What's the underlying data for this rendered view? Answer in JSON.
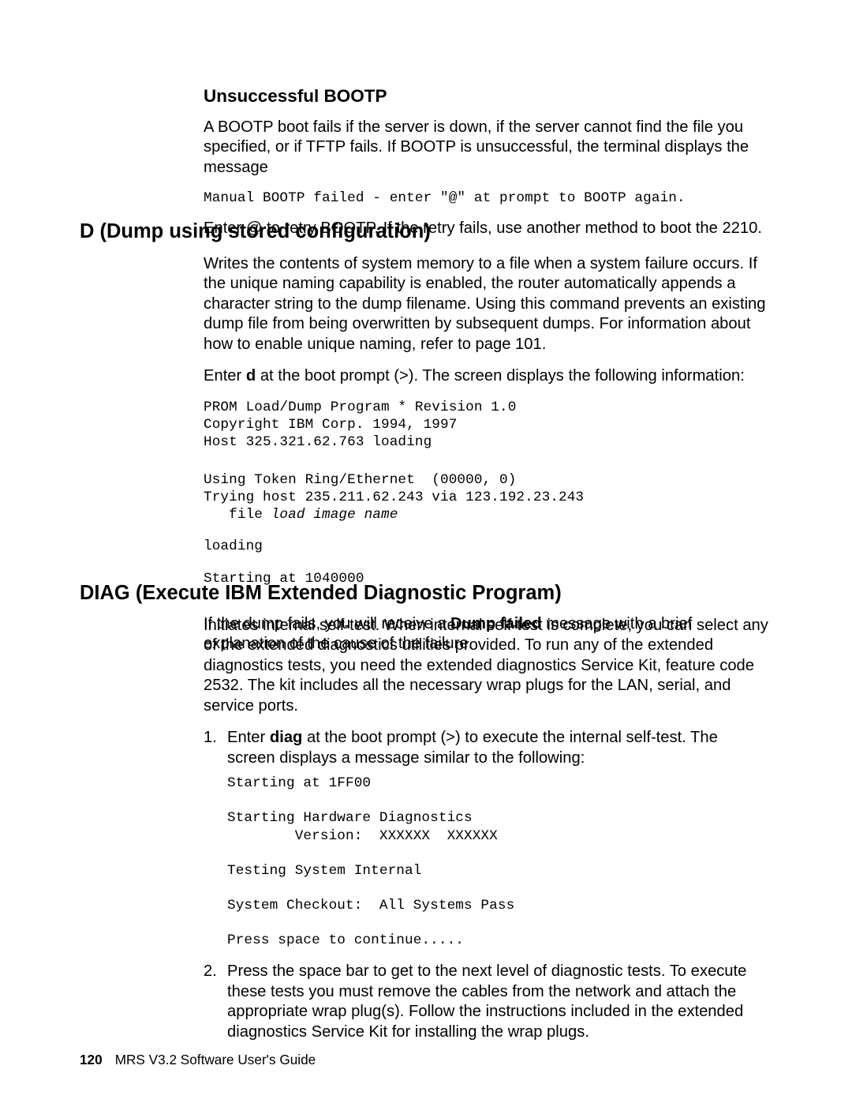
{
  "sections": {
    "bootp": {
      "heading": "Unsuccessful BOOTP",
      "p1": "A BOOTP boot fails if the server is down, if the server cannot find the file you specified, or if TFTP fails. If BOOTP is unsuccessful, the terminal displays the message",
      "code1": "Manual BOOTP failed - enter \"@\" at prompt to BOOTP again.",
      "p2": "Enter @ to retry BOOTP. If the retry fails, use another method to boot the 2210."
    },
    "dump": {
      "heading": "D (Dump using stored configuration)",
      "p1": "Writes the contents of system memory to a file when a system failure occurs. If the unique naming capability is enabled, the router automatically appends a character string to the dump filename. Using this command prevents an existing dump file from being overwritten by subsequent dumps. For information about how to enable unique naming, refer to page 101.",
      "p2_pre": "Enter ",
      "p2_bold": "d",
      "p2_post": " at the boot prompt (>). The screen displays the following information:",
      "code_a": "PROM Load/Dump Program * Revision 1.0\nCopyright IBM Corp. 1994, 1997\nHost 325.321.62.763 loading",
      "code_b_l1": "Using Token Ring/Ethernet  (00000, 0)",
      "code_b_l2": "Trying host 235.211.62.243 via 123.192.23.243",
      "code_b_l3_pre": "   file ",
      "code_b_l3_ital": "load image name",
      "code_c": "loading",
      "code_d": "Starting at 1040000",
      "p3_pre": "If the dump fails, you will receive a ",
      "p3_bold": "Dump failed",
      "p3_post": " message with a brief explanation of the cause of the failure."
    },
    "diag": {
      "heading": "DIAG (Execute IBM Extended Diagnostic Program)",
      "p1": "Initiates internal self-test. When internal self-test is complete, you can select any of the extended diagnostics utilities provided. To run any of the extended diagnostics tests, you need the extended diagnostics Service Kit, feature code 2532. The kit includes all the necessary wrap plugs for the LAN, serial, and service ports.",
      "li1_num": "1.",
      "li1_pre": "Enter ",
      "li1_bold": "diag",
      "li1_post": " at the boot prompt (>) to execute the internal self-test. The screen displays a message similar to the following:",
      "li1_code": "Starting at 1FF00\n\nStarting Hardware Diagnostics\n        Version:  XXXXXX  XXXXXX\n\nTesting System Internal\n\nSystem Checkout:  All Systems Pass\n\nPress space to continue.....",
      "li2_num": "2.",
      "li2": "Press the space bar to get to the next level of diagnostic tests. To execute these tests you must remove the cables from the network and attach the appropriate wrap plug(s). Follow the instructions included in the extended diagnostics Service Kit for installing the wrap plugs."
    }
  },
  "footer": {
    "page": "120",
    "title": "MRS V3.2 Software User's Guide"
  }
}
